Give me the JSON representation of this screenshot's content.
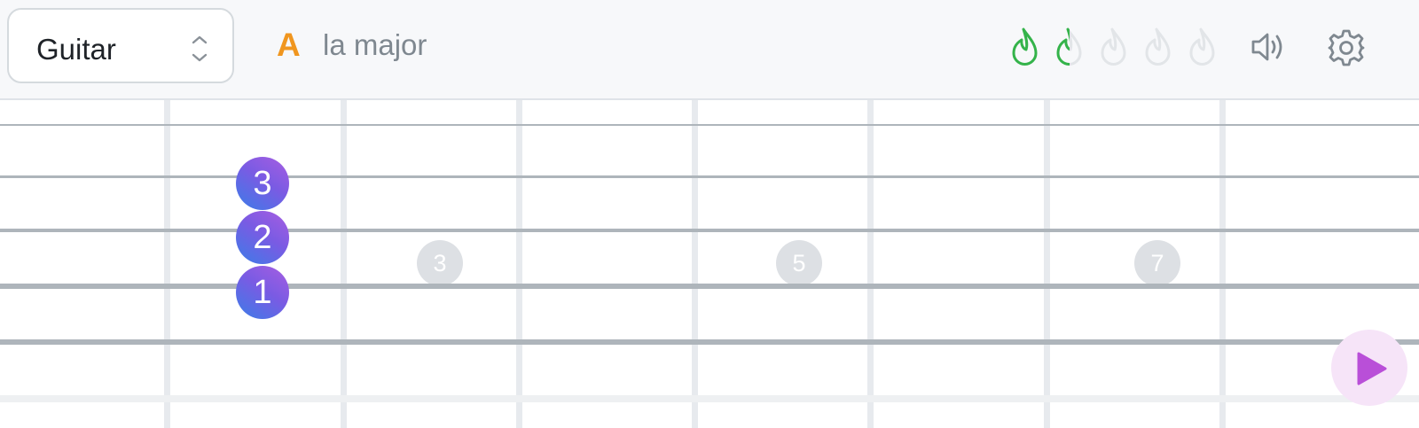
{
  "header": {
    "instrument": "Guitar",
    "chord_root": "A",
    "chord_name": "la major",
    "streak": {
      "filled": 1.5,
      "total": 5,
      "color_on": "#34b34a",
      "color_off": "#e2e5e8"
    }
  },
  "fret_markers": [
    "3",
    "5",
    "7"
  ],
  "fingers": [
    "3",
    "2",
    "1"
  ],
  "colors": {
    "accent_orange": "#f0961f",
    "finger_gradient": [
      "#3b7de8",
      "#a85ee2"
    ],
    "play": "#b94fd8"
  },
  "icons": {
    "instrument_selector": "chevron-up-down-icon",
    "streak": "flame-icon",
    "sound": "speaker-icon",
    "settings": "gear-icon",
    "play": "play-icon"
  }
}
